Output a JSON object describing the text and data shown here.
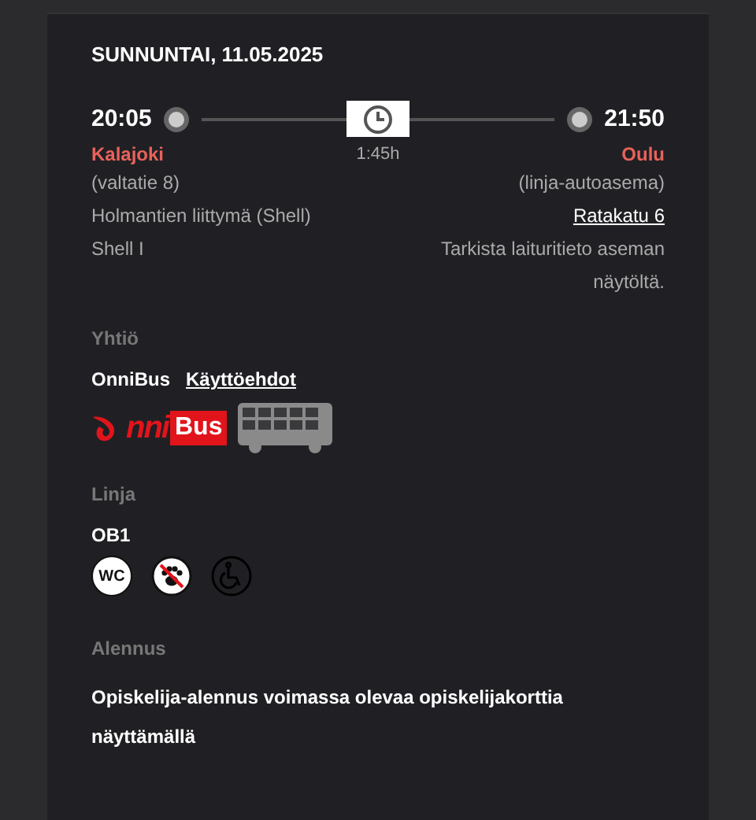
{
  "date": "SUNNUNTAI, 11.05.2025",
  "departure": {
    "time": "20:05",
    "station": "Kalajoki",
    "details": [
      {
        "text": "(valtatie 8)",
        "link": false
      },
      {
        "text": "Holmantien liittymä (Shell)",
        "link": false
      },
      {
        "text": "Shell I",
        "link": false
      }
    ]
  },
  "duration": "1:45h",
  "arrival": {
    "time": "21:50",
    "station": "Oulu",
    "details": [
      {
        "text": "(linja-autoasema)",
        "link": false
      },
      {
        "text": "Ratakatu 6",
        "link": true
      },
      {
        "text": "Tarkista laituritieto aseman näytöltä.",
        "link": false
      }
    ]
  },
  "company": {
    "label": "Yhtiö",
    "name": "OnniBus",
    "terms_link": "Käyttöehdot",
    "logo": {
      "script_text": "nni",
      "boxed_text": "Bus"
    }
  },
  "line": {
    "label": "Linja",
    "code": "OB1",
    "amenities": [
      {
        "kind": "wc",
        "text": "WC",
        "available": true
      },
      {
        "kind": "pets",
        "available": true
      },
      {
        "kind": "wheelchair",
        "available": false
      }
    ]
  },
  "discount": {
    "label": "Alennus",
    "text": "Opiskelija-alennus voimassa olevaa opiskelijakorttia näyttämällä"
  }
}
